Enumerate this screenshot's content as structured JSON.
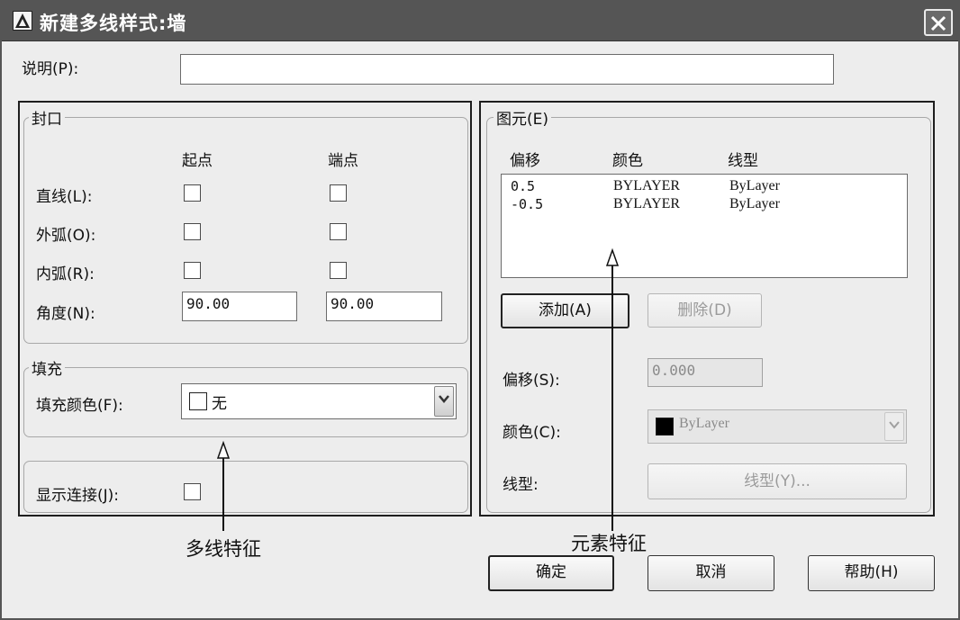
{
  "window": {
    "title": "新建多线样式:墙",
    "app_icon": "autocad-logo-icon",
    "close_icon": "close-icon"
  },
  "description": {
    "label": "说明(P):",
    "value": ""
  },
  "caps": {
    "title": "封口",
    "col_start": "起点",
    "col_end": "端点",
    "line_label": "直线(L):",
    "outer_arc_label": "外弧(O):",
    "inner_arc_label": "内弧(R):",
    "angle_label": "角度(N):",
    "angle_start": "90.00",
    "angle_end": "90.00",
    "checked": {
      "line_start": false,
      "line_end": false,
      "outer_start": false,
      "outer_end": false,
      "inner_start": false,
      "inner_end": false
    }
  },
  "fill": {
    "title": "填充",
    "color_label": "填充颜色(F):",
    "color_value": "无",
    "swatch_color": "#ffffff"
  },
  "display_joints": {
    "label": "显示连接(J):",
    "checked": false
  },
  "elements": {
    "title": "图元(E)",
    "headers": {
      "offset": "偏移",
      "color": "颜色",
      "linetype": "线型"
    },
    "rows": [
      {
        "offset": "0.5",
        "color": "BYLAYER",
        "linetype": "ByLayer"
      },
      {
        "offset": "-0.5",
        "color": "BYLAYER",
        "linetype": "ByLayer"
      }
    ],
    "add_button": "添加(A)",
    "delete_button": "删除(D)",
    "offset_label": "偏移(S):",
    "offset_value": "0.000",
    "color_label": "颜色(C):",
    "color_value": "ByLayer",
    "color_swatch": "#000000",
    "linetype_label": "线型:",
    "linetype_button": "线型(Y)..."
  },
  "annotations": {
    "left": "多线特征",
    "right": "元素特征"
  },
  "footer": {
    "ok": "确定",
    "cancel": "取消",
    "help": "帮助(H)"
  }
}
